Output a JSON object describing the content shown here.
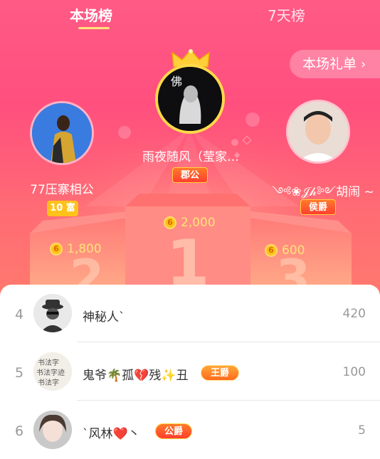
{
  "tabs": [
    {
      "label": "本场榜",
      "active": true
    },
    {
      "label": "7天榜",
      "active": false
    }
  ],
  "gift_list_label": "本场礼单",
  "podium": {
    "first": {
      "name": "雨夜随风（莹家…",
      "badge": "郡公",
      "score": "2,000",
      "rank_digit": "1"
    },
    "second": {
      "name": "77压寨相公",
      "badge": "10 富",
      "score": "1,800",
      "rank_digit": "2"
    },
    "third": {
      "name": "༺❀𝒥𝒽༻胡闹 ~",
      "badge": "侯爵",
      "score": "600",
      "rank_digit": "3"
    }
  },
  "list": [
    {
      "rank": "4",
      "name": "神秘人`",
      "badge": "",
      "value": "420"
    },
    {
      "rank": "5",
      "name": "鬼爷🌴孤💔残✨丑",
      "badge": "王爵",
      "value": "100"
    },
    {
      "rank": "6",
      "name": "ˋ风林❤️丶",
      "badge": "公爵",
      "value": "5"
    }
  ],
  "coin_glyph": "6",
  "colors": {
    "accent_yellow": "#ffe27a",
    "pink": "#ff4f7e",
    "badge_orange": "#ff8a2a"
  }
}
